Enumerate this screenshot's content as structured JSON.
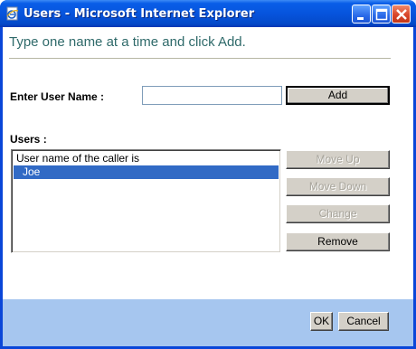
{
  "window": {
    "title": "Users - Microsoft Internet Explorer",
    "titlebar_color": "#0654dd",
    "icons": [
      "ie-page-icon",
      "minimize-icon",
      "maximize-icon",
      "close-icon"
    ]
  },
  "dialog": {
    "heading": "Type one name at a time and click Add.",
    "user_name_label": "Enter User Name :",
    "user_name_value": "",
    "add_label": "Add",
    "users_label": "Users :",
    "users": [
      {
        "label": "User name of the caller is",
        "selected": false
      },
      {
        "label": "Joe",
        "selected": true
      }
    ],
    "move_up_label": "Move Up",
    "move_down_label": "Move Down",
    "change_label": "Change",
    "remove_label": "Remove"
  },
  "footer": {
    "ok_label": "OK",
    "cancel_label": "Cancel",
    "background": "#a6c6ef"
  },
  "colors": {
    "heading": "#2f6a6a",
    "selection": "#316ac5"
  }
}
